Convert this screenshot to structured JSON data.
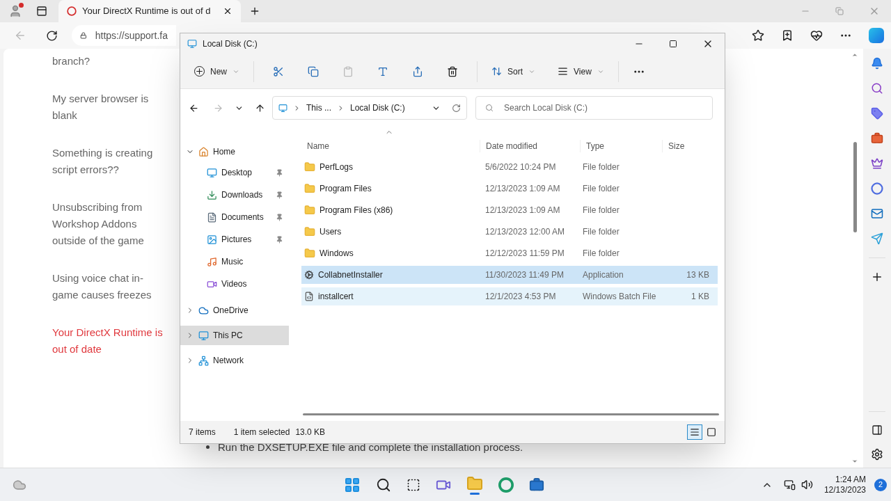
{
  "browser": {
    "tabs": [
      {
        "title": "Your DirectX Runtime is out of d",
        "selected": true
      }
    ],
    "address": "https://support.fa"
  },
  "page": {
    "articles": [
      {
        "title": "branch?",
        "selected": false
      },
      {
        "title": "My server browser is blank",
        "selected": false
      },
      {
        "title": "Something is creating script errors??",
        "selected": false
      },
      {
        "title": "Unsubscribing from Workshop Addons outside of the game",
        "selected": false
      },
      {
        "title": "Using voice chat in-game causes freezes",
        "selected": false
      },
      {
        "title": "Your DirectX Runtime is out of date",
        "selected": true
      }
    ],
    "steps": [
      "Run the DXSETUP.EXE file and complete the installation process."
    ]
  },
  "explorer": {
    "title": "Local Disk (C:)",
    "toolbar": {
      "new": "New",
      "sort": "Sort",
      "view": "View"
    },
    "breadcrumb": [
      "This ...",
      "Local Disk (C:)"
    ],
    "search": {
      "placeholder": "Search Local Disk (C:)"
    },
    "nav": [
      {
        "label": "Home",
        "kind": "home",
        "expanded": true,
        "selected": false,
        "children": [
          {
            "label": "Desktop",
            "kind": "desktop",
            "pinned": true
          },
          {
            "label": "Downloads",
            "kind": "downloads",
            "pinned": true
          },
          {
            "label": "Documents",
            "kind": "documents",
            "pinned": true
          },
          {
            "label": "Pictures",
            "kind": "pictures",
            "pinned": true
          },
          {
            "label": "Music",
            "kind": "music",
            "pinned": false
          },
          {
            "label": "Videos",
            "kind": "videos",
            "pinned": false
          }
        ]
      },
      {
        "label": "OneDrive",
        "kind": "cloud",
        "expanded": false,
        "selected": false
      },
      {
        "label": "This PC",
        "kind": "pc",
        "expanded": false,
        "selected": true
      },
      {
        "label": "Network",
        "kind": "network",
        "expanded": false,
        "selected": false
      }
    ],
    "columns": [
      "Name",
      "Date modified",
      "Type",
      "Size"
    ],
    "files": [
      {
        "name": "PerfLogs",
        "date": "5/6/2022 10:24 PM",
        "type": "File folder",
        "kind": "folder",
        "selected": false,
        "hovered": false
      },
      {
        "name": "Program Files",
        "date": "12/13/2023 1:09 AM",
        "type": "File folder",
        "kind": "folder",
        "selected": false,
        "hovered": false
      },
      {
        "name": "Program Files (x86)",
        "date": "12/13/2023 1:09 AM",
        "type": "File folder",
        "kind": "folder",
        "selected": false,
        "hovered": false
      },
      {
        "name": "Users",
        "date": "12/13/2023 12:00 AM",
        "type": "File folder",
        "kind": "folder",
        "selected": false,
        "hovered": false
      },
      {
        "name": "Windows",
        "date": "12/12/2023 11:59 PM",
        "type": "File folder",
        "kind": "folder",
        "selected": false,
        "hovered": false
      },
      {
        "name": "CollabnetInstaller",
        "date": "11/30/2023 11:49 PM",
        "type": "Application",
        "size": "13 KB",
        "kind": "app",
        "selected": true,
        "hovered": false
      },
      {
        "name": "installcert",
        "date": "12/1/2023 4:53 PM",
        "type": "Windows Batch File",
        "size": "1 KB",
        "kind": "batch",
        "selected": false,
        "hovered": true
      }
    ],
    "status": {
      "count": "7 items",
      "selection": "1 item selected",
      "size": "13.0 KB"
    },
    "views": [
      {
        "kind": "details",
        "selected": true
      },
      {
        "kind": "tiles",
        "selected": false
      }
    ]
  },
  "taskbar": {
    "time": "1:24 AM",
    "date": "12/13/2023",
    "notifications": "2"
  }
}
